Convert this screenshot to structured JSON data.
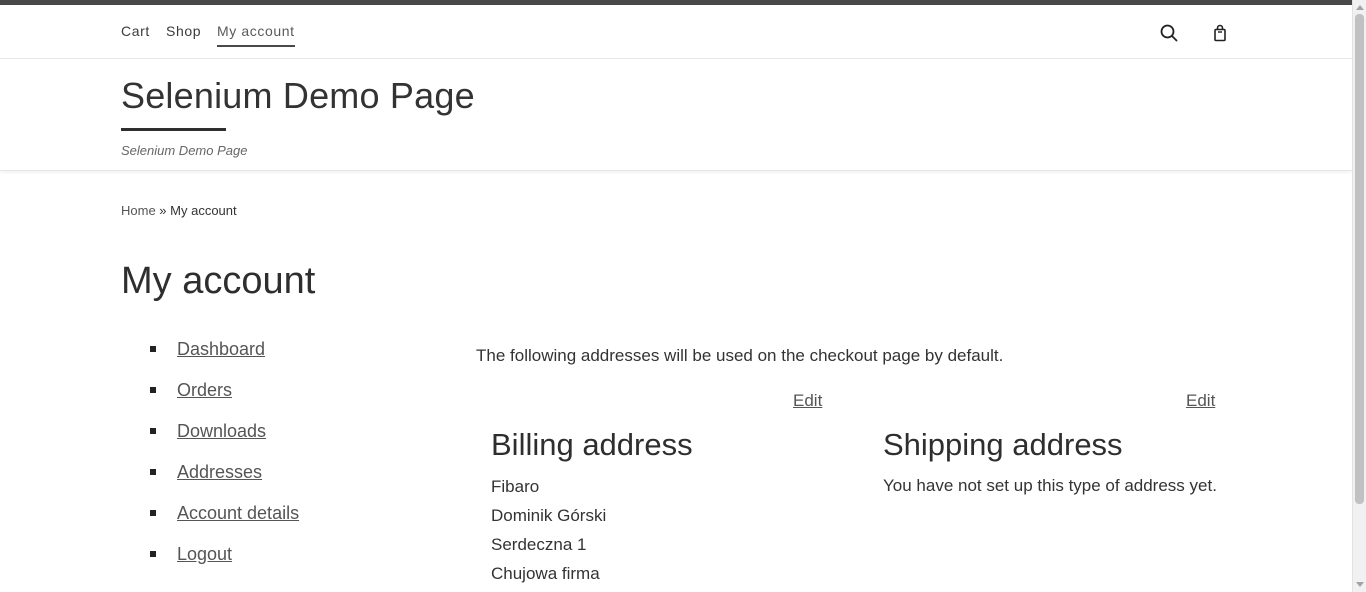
{
  "header": {
    "nav": [
      {
        "label": "Cart"
      },
      {
        "label": "Shop"
      },
      {
        "label": "My account",
        "active": true
      }
    ],
    "icons": [
      "search-icon",
      "shopping-bag-icon"
    ]
  },
  "branding": {
    "site_title": "Selenium Demo Page",
    "tagline": "Selenium Demo Page"
  },
  "breadcrumb": {
    "home": "Home",
    "separator": " » ",
    "current": "My account"
  },
  "page_title": "My account",
  "account_nav": [
    {
      "label": "Dashboard"
    },
    {
      "label": "Orders"
    },
    {
      "label": "Downloads"
    },
    {
      "label": "Addresses"
    },
    {
      "label": "Account details"
    },
    {
      "label": "Logout"
    }
  ],
  "addresses": {
    "intro": "The following addresses will be used on the checkout page by default.",
    "billing": {
      "heading": "Billing address",
      "edit_label": "Edit",
      "lines": [
        "Fibaro",
        "Dominik Górski",
        "Serdeczna 1",
        "Chujowa firma"
      ]
    },
    "shipping": {
      "heading": "Shipping address",
      "edit_label": "Edit",
      "empty_text": "You have not set up this type of address yet."
    }
  },
  "colors": {
    "top_stripe": "#484848",
    "text": "#333333",
    "link": "#555555"
  }
}
